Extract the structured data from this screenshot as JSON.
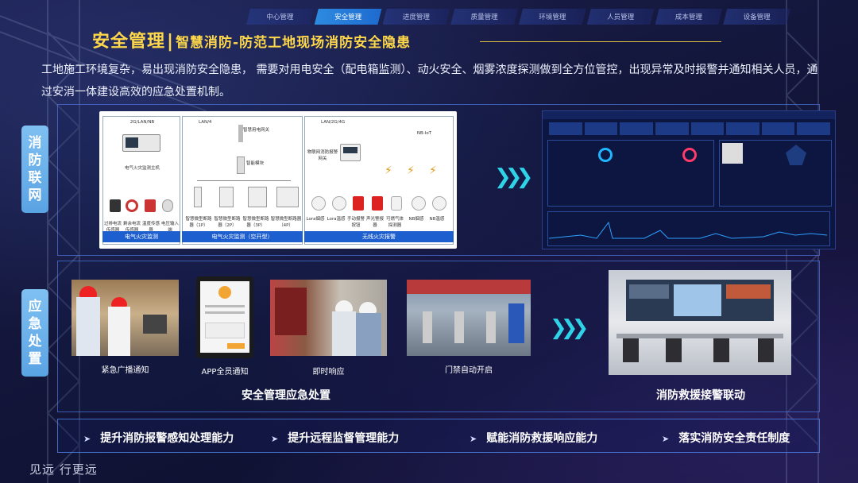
{
  "nav": {
    "tabs": [
      "中心管理",
      "安全管理",
      "进度管理",
      "质量管理",
      "环境管理",
      "人员管理",
      "成本管理",
      "设备管理"
    ],
    "active_index": 1
  },
  "title": {
    "main": "安全管理",
    "separator": "|",
    "sub": "智慧消防-防范工地现场消防安全隐患"
  },
  "description": "工地施工环境复杂，易出现消防安全隐患， 需要对用电安全（配电箱监测）、动火安全、烟雾浓度探测做到全方位管控，出现异常及时报警并通知相关人员，通过安消一体建设高效的应急处置机制。",
  "section1": {
    "label": [
      "消",
      "防",
      "联",
      "网"
    ],
    "diagram": {
      "col1": {
        "net": "2G/LAN/NB",
        "host": "电气火灾监测主机",
        "sensors": [
          "过排电流传感器",
          "剩余电流传感器",
          "温度传感器",
          "电压输入端"
        ],
        "footer": "电气火灾监测"
      },
      "col2": {
        "net": "LAN/4",
        "gateway": "智慧用电网关",
        "module": "智能模块",
        "breakers": [
          "智慧微型断路器（1P）",
          "智慧微型断路器（2P）",
          "智慧微型断路器（3P）",
          "智慧微型断路器（4P）"
        ],
        "footer": "电气火灾监测（空开型）"
      },
      "col3": {
        "net": "LAN/2G/4G",
        "gateway": "物联网消防报警网关",
        "nbiot": "NB-IoT",
        "devices": [
          "Lora烟感",
          "Lora温感",
          "手动报警按钮",
          "声光警报器",
          "可燃气体探测器",
          "NB烟感",
          "NB温感"
        ],
        "footer": "无线火灾报警"
      }
    }
  },
  "section2": {
    "label": [
      "应",
      "急",
      "处",
      "置"
    ],
    "photos": [
      "紧急广播通知",
      "APP全员通知",
      "即时响应",
      "门禁自动开启"
    ],
    "group_caption": "安全管理应急处置",
    "right_caption": "消防救援接警联动"
  },
  "arrow_glyph": "❯❯❯",
  "highlights": [
    "提升消防报警感知处理能力",
    "提升远程监督管理能力",
    "赋能消防救援响应能力",
    "落实消防安全责任制度"
  ],
  "footer": "见远 行更远",
  "colors": {
    "title": "#ffd84a",
    "accent_blue": "#2d8be0",
    "side_label": "#6bb1ea",
    "arrow": "#2fd3e8"
  }
}
